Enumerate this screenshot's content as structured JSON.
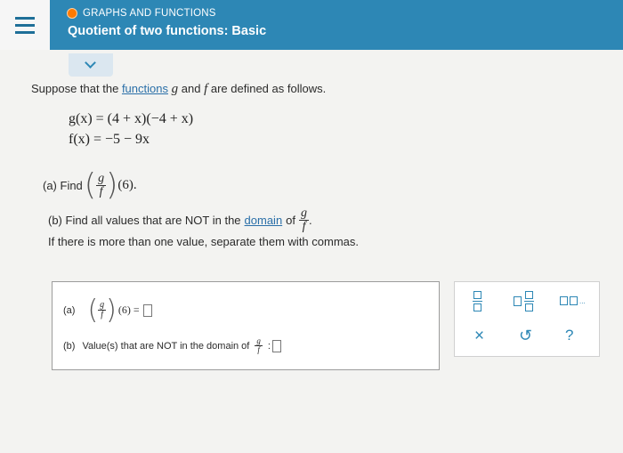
{
  "header": {
    "breadcrumb": "GRAPHS AND FUNCTIONS",
    "title": "Quotient of two functions: Basic"
  },
  "problem": {
    "intro_before": "Suppose that the",
    "functions_link": "functions",
    "intro_after": "are defined as follows.",
    "g_var": "g",
    "f_var": "f",
    "and": "and",
    "g_def": "g(x) = (4 + x)(−4 + x)",
    "f_def": "f(x) = −5 − 9x",
    "part_a_label": "(a) Find",
    "part_a_arg": "(6).",
    "part_b_text": "(b) Find all values that are NOT in the domain of",
    "domain_link": "domain",
    "part_b_of": "of",
    "part_b_period": ".",
    "instruction": "If there is more than one value, separate them with commas."
  },
  "answer": {
    "a_label": "(a)",
    "a_expr": "(6) =",
    "b_label": "(b)",
    "b_text": "Value(s) that are NOT in the domain of",
    "b_colon": ":"
  },
  "tools": {
    "clear": "×",
    "undo": "↺",
    "help": "?"
  },
  "colors": {
    "header_bg": "#2d87b5",
    "accent_orange": "#ff7a00",
    "link": "#2a6fa8"
  }
}
